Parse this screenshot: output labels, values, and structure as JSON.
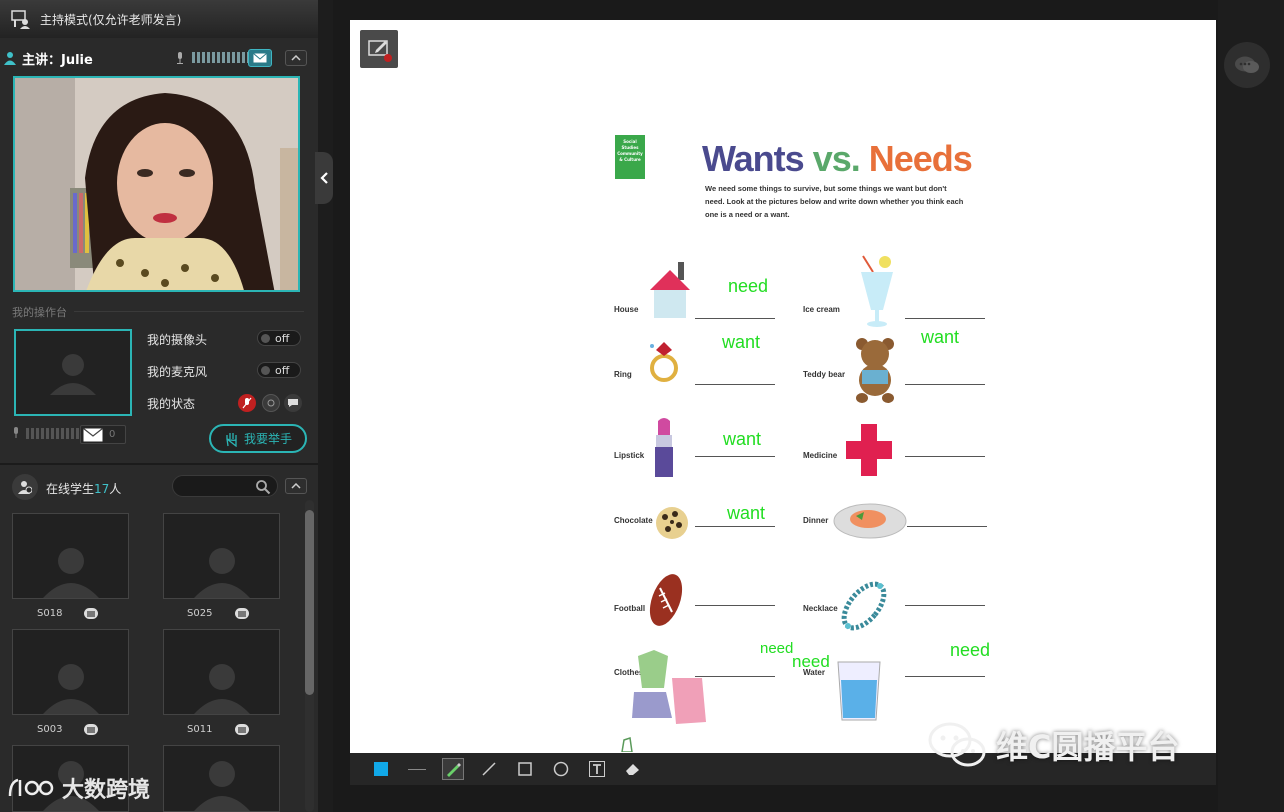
{
  "titlebar": {
    "title": "主持模式(仅允许老师发言)"
  },
  "lecturer": {
    "label": "主讲：Julie",
    "mic_level": 8
  },
  "console": {
    "label": "我的操作台",
    "camera_label": "我的摄像头",
    "camera_state": "off",
    "mic_label": "我的麦克风",
    "mic_state": "off",
    "status_label": "我的状态",
    "msg_count": "0",
    "raise_hand": "我要举手"
  },
  "online": {
    "label": "在线学生",
    "count": "17",
    "unit": "人",
    "search_placeholder": ""
  },
  "students": [
    {
      "name": "S018"
    },
    {
      "name": "S025"
    },
    {
      "name": "S003"
    },
    {
      "name": "S011"
    },
    {
      "name": ""
    },
    {
      "name": ""
    }
  ],
  "brand_left": "大数跨境",
  "watermark": "维C圆播平台",
  "worksheet": {
    "tag": "Social Studies Community & Culture",
    "title_wants": "Wants",
    "title_vs": "vs.",
    "title_needs": "Needs",
    "instructions": "We need some things to survive, but some things we want but don't need. Look at the pictures below and write down whether you think each one is a need or a want.",
    "items": [
      {
        "label": "House",
        "answer": "need"
      },
      {
        "label": "Ice cream",
        "answer": ""
      },
      {
        "label": "Ring",
        "answer": "want"
      },
      {
        "label": "Teddy bear",
        "answer": "want"
      },
      {
        "label": "Lipstick",
        "answer": "want"
      },
      {
        "label": "Medicine",
        "answer": ""
      },
      {
        "label": "Chocolate",
        "answer": "want"
      },
      {
        "label": "Dinner",
        "answer": ""
      },
      {
        "label": "Football",
        "answer": ""
      },
      {
        "label": "Necklace",
        "answer": ""
      },
      {
        "label": "Clothes",
        "answer": "need"
      },
      {
        "label": "Water",
        "answer": "need"
      }
    ],
    "extra_annotation": "need"
  },
  "colors": {
    "accent": "#2bb5b5",
    "handwriting": "#22dd22",
    "panel": "#2a2a2a"
  },
  "toolbar": {
    "tools": [
      "color-swatch",
      "line-thin",
      "highlighter",
      "pen",
      "rectangle",
      "ellipse",
      "text",
      "eraser"
    ]
  }
}
